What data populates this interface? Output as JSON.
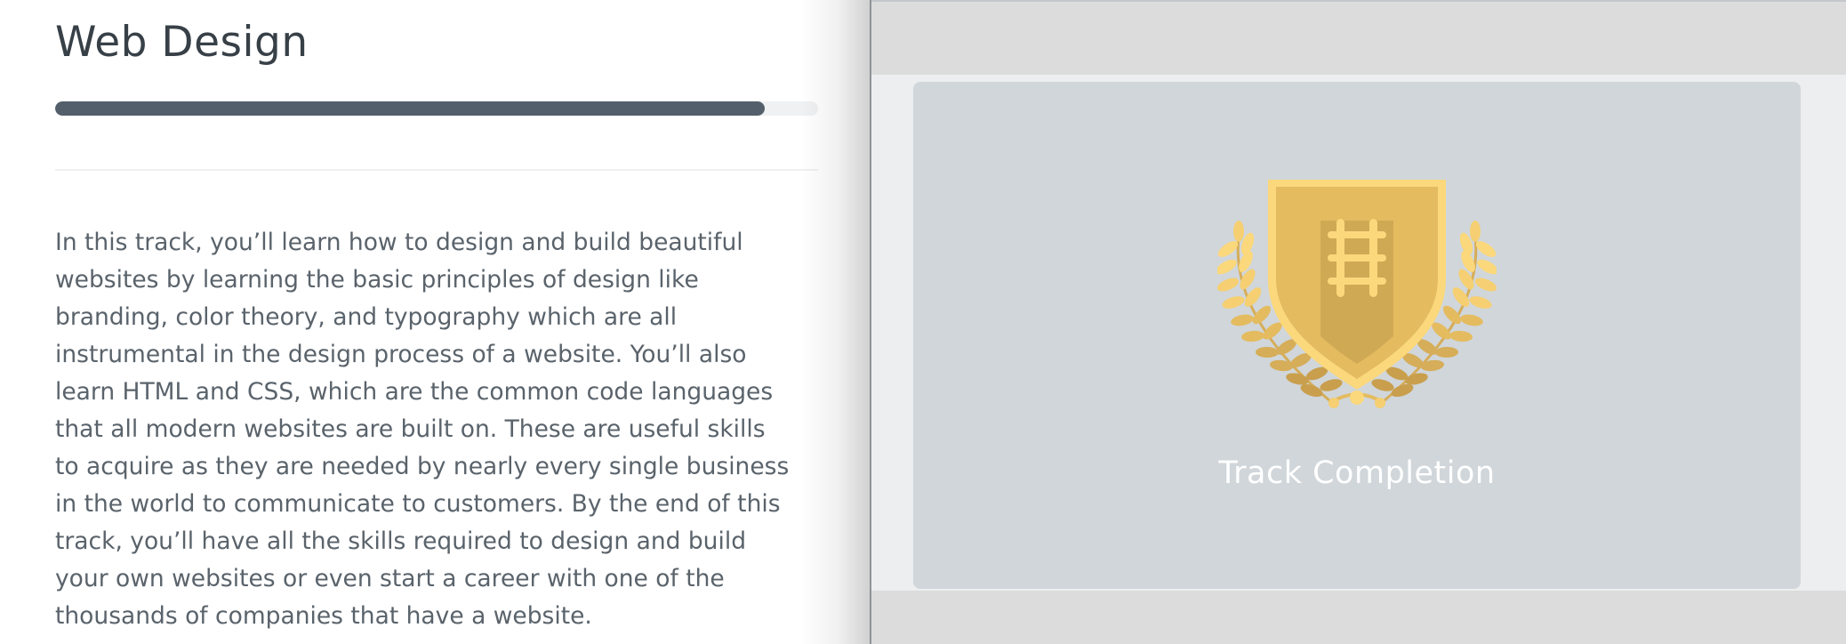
{
  "track": {
    "title": "Web Design",
    "progress_fraction": 0.93,
    "description_lines": [
      "In this track, you’ll learn how to design and build beautiful",
      "websites by learning the basic principles of design like",
      "branding, color theory, and typography which are all",
      "instrumental in the design process of a website. You’ll also",
      "learn HTML and CSS, which are the common code languages",
      "that all modern websites are built on. These are useful skills",
      "to acquire as they are needed by nearly every single business",
      "in the world to communicate to customers. By the end of this",
      "track, you’ll have all the skills required to design and build",
      "your own websites or even start a career with one of the",
      "thousands of companies that have a website."
    ]
  },
  "preview": {
    "caption": "Track Completion",
    "badge_icon": "track-completion-badge-icon"
  },
  "colors": {
    "progress_fill": "#535f6a",
    "progress_track": "#eff1f3",
    "card_background": "#d0d6da",
    "badge_gold": "#e4bb5f",
    "badge_gold_light": "#fbd87c",
    "badge_gold_dark": "#c49a4a"
  }
}
